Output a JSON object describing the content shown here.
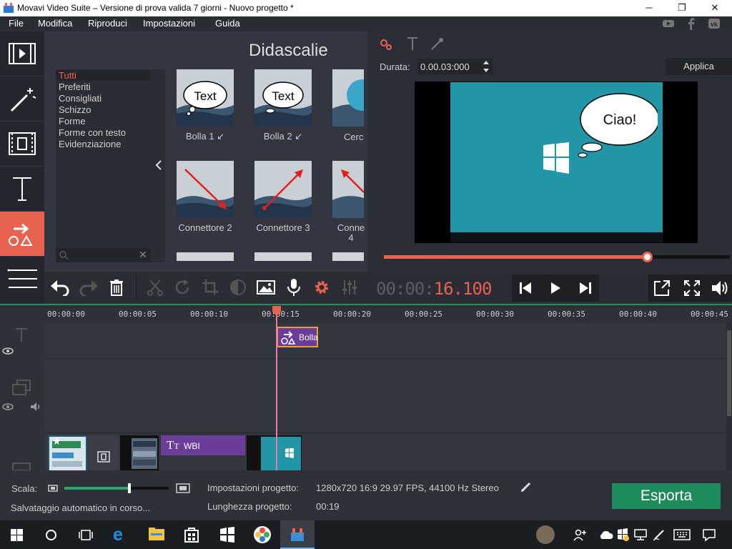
{
  "window": {
    "title": "Movavi Video Suite – Versione di prova valida 7 giorni - Nuovo progetto *",
    "minimize_icon": "─",
    "maximize_icon": "❐",
    "close_icon": "✕"
  },
  "menu": [
    "File",
    "Modifica",
    "Riproduci",
    "Impostazioni",
    "Guida"
  ],
  "social": [
    "youtube-icon",
    "facebook-icon",
    "vk-icon"
  ],
  "library": {
    "title": "Didascalie",
    "categories": [
      "Tutti",
      "Preferiti",
      "Consigliati",
      "Schizzo",
      "Forme",
      "Forme con testo",
      "Evidenziazione"
    ],
    "active_category": "Tutti",
    "items": [
      {
        "label": "Bolla 1 ↙",
        "bubble_text": "Text"
      },
      {
        "label": "Bolla 2 ↙",
        "bubble_text": "Text"
      },
      {
        "label": "Cerc"
      },
      {
        "label": "Connettore 2"
      },
      {
        "label": "Connettore 3"
      },
      {
        "label": "Conne 4"
      }
    ]
  },
  "properties": {
    "duration_label": "Durata:",
    "duration_value": "0.00.03:000",
    "apply_label": "Applica"
  },
  "preview": {
    "bubble_text": "Ciao!",
    "progress": 0.76,
    "timecode_dim": "00:00:",
    "timecode_active": "16.100"
  },
  "timeline": {
    "ruler": [
      "00:00:00",
      "00:00:05",
      "00:00:10",
      "00:00:15",
      "00:00:20",
      "00:00:25",
      "00:00:30",
      "00:00:35",
      "00:00:40",
      "00:00:45"
    ],
    "callout_clip": "Bolla",
    "title_clip": "WBI"
  },
  "status": {
    "scale_label": "Scala:",
    "autosave": "Salvataggio automatico in corso...",
    "settings_label": "Impostazioni progetto:",
    "settings_value": "1280x720 16:9 29.97 FPS, 44100 Hz Stereo",
    "length_label": "Lunghezza progetto:",
    "length_value": "00:19",
    "export_label": "Esporta",
    "scale_level": 0.62
  },
  "colors": {
    "accent": "#e8624f",
    "export": "#1f8a5a",
    "callout": "#6a3d9a"
  }
}
